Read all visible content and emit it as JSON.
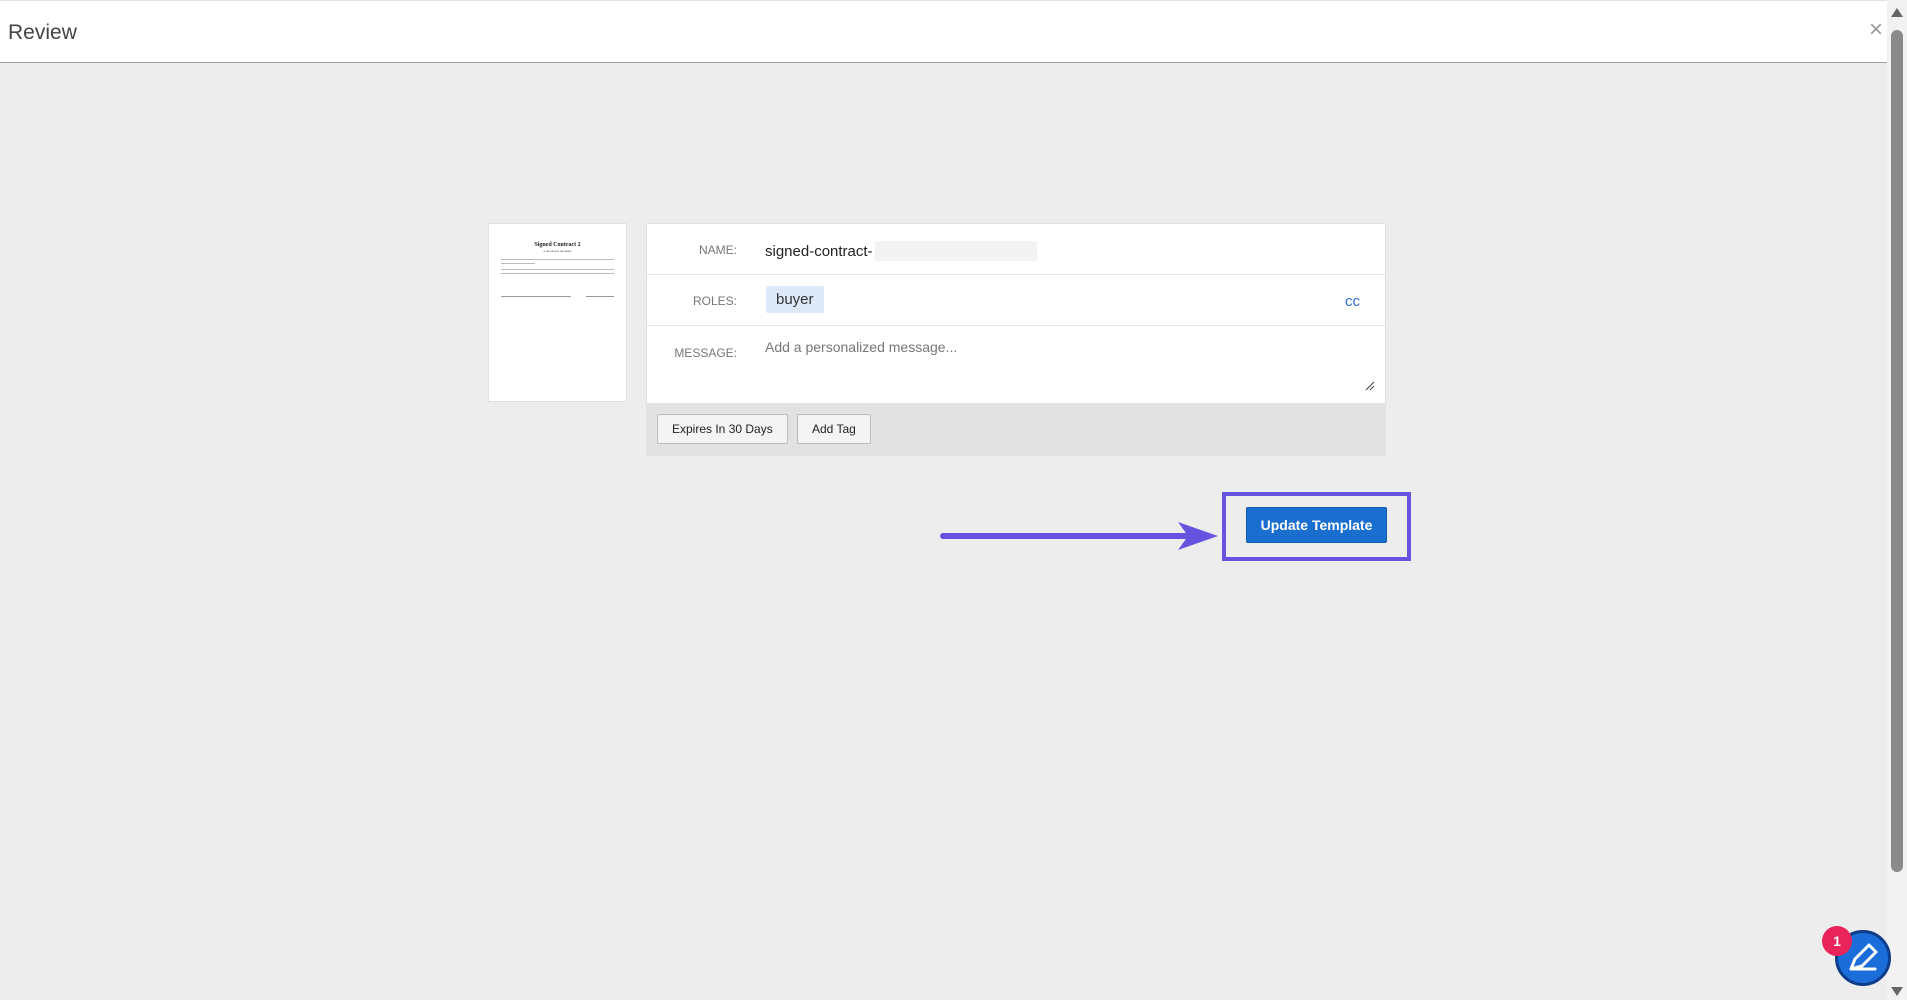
{
  "header": {
    "title": "Review",
    "close_icon": "close-icon"
  },
  "thumbnail": {
    "doc_title": "Signed Contract 2",
    "doc_subtitle": "a document template"
  },
  "form": {
    "name_label": "NAME:",
    "name_value": "signed-contract-",
    "roles_label": "ROLES:",
    "role_chip": "buyer",
    "cc_link": "cc",
    "message_label": "MESSAGE:",
    "message_placeholder": "Add a personalized message...",
    "message_value": ""
  },
  "actions": {
    "expires_label": "Expires In 30 Days",
    "add_tag_label": "Add Tag"
  },
  "primary": {
    "update_label": "Update Template"
  },
  "widget": {
    "badge_count": "1",
    "icon": "edit-icon"
  },
  "colors": {
    "accent": "#1a6ecf",
    "highlight": "#6654e0",
    "badge": "#e8245a",
    "chip": "#dde8f8"
  }
}
